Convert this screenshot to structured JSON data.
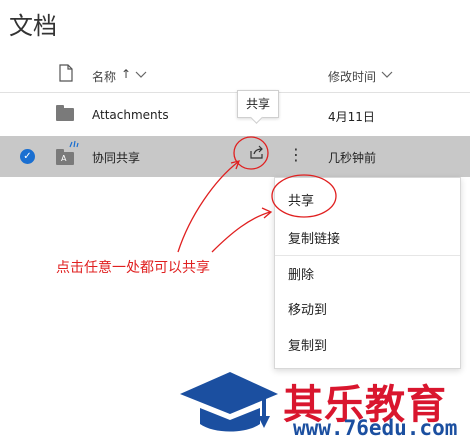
{
  "page": {
    "title": "文档"
  },
  "header": {
    "name_label": "名称",
    "sort_arrow": "↑",
    "modified_label": "修改时间"
  },
  "rows": [
    {
      "name": "Attachments",
      "modified": "4月11日",
      "selected": false
    },
    {
      "name": "协同共享",
      "modified": "几秒钟前",
      "selected": true
    }
  ],
  "tooltip": {
    "text": "共享"
  },
  "context_menu": {
    "items": [
      {
        "label": "共享"
      },
      {
        "label": "复制链接"
      },
      {
        "label": "删除"
      },
      {
        "label": "移动到"
      },
      {
        "label": "复制到"
      }
    ]
  },
  "annotation": {
    "text": "点击任意一处都可以共享"
  },
  "watermark": {
    "brand": "其乐教育",
    "url": "www.76edu.com"
  },
  "colors": {
    "selected_row": "#c8c8c8",
    "checkbox": "#1a6fd1",
    "annotation": "#e02020",
    "brand_red": "#d9162e",
    "brand_blue": "#1b4fa0"
  },
  "icons": [
    "file-icon",
    "folder-icon",
    "shared-folder-icon",
    "share-icon",
    "more-icon",
    "check-icon",
    "chevron-down-icon",
    "graduation-cap-icon"
  ]
}
